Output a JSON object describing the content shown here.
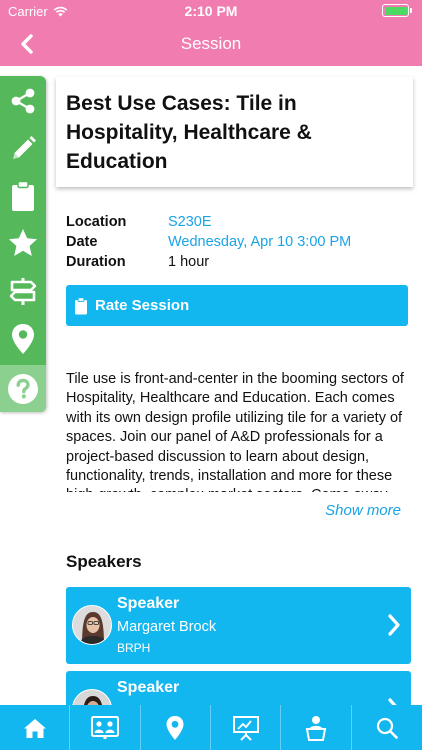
{
  "status_bar": {
    "carrier": "Carrier",
    "time": "2:10 PM"
  },
  "nav": {
    "title": "Session",
    "back_icon": "chevron-left-icon"
  },
  "side_tools": [
    "share-icon",
    "pencil-icon",
    "clipboard-icon",
    "star-icon",
    "signpost-icon",
    "location-pin-icon",
    "help-icon"
  ],
  "session": {
    "title": "Best Use Cases: Tile in Hospitality, Healthcare & Education",
    "location_label": "Location",
    "location_value": "S230E",
    "date_label": "Date",
    "date_value": "Wednesday, Apr 10 3:00 PM",
    "duration_label": "Duration",
    "duration_value": "1 hour",
    "rate_button": "Rate Session",
    "description": "Tile use is front-and-center in the booming sectors of Hospitality, Healthcare and Education. Each comes with its own design profile utilizing tile for a variety of spaces. Join our panel of A&D professionals for a project-based discussion to learn about design, functionality, trends, installation and more for these high-growth, complex market sectors. Come away better",
    "show_more": "Show more"
  },
  "speakers": {
    "heading": "Speakers",
    "items": [
      {
        "role": "Speaker",
        "name": "Margaret Brock",
        "org": "BRPH"
      },
      {
        "role": "Speaker",
        "name": "",
        "org": ""
      }
    ]
  },
  "tab_bar": [
    "home-icon",
    "exhibitors-icon",
    "map-pin-icon",
    "presentation-icon",
    "speaker-podium-icon",
    "search-icon"
  ],
  "colors": {
    "header": "#f07cb0",
    "accent": "#13b7f0",
    "side_tools": "#55b85a",
    "link": "#1aa4e6"
  }
}
